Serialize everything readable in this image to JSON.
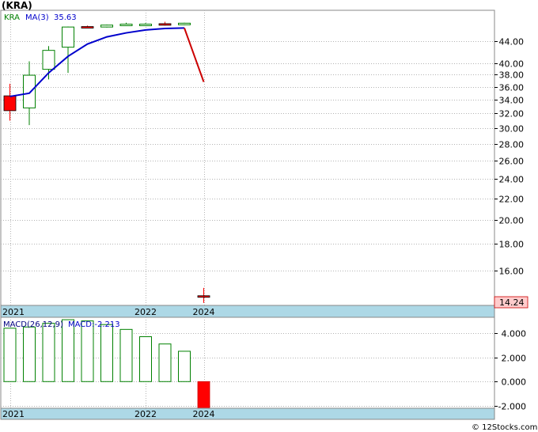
{
  "chart_data": [
    {
      "type": "candlestick",
      "title": "(KRA)",
      "legend": [
        {
          "label": "KRA",
          "color": "#008000"
        },
        {
          "label": "MA(3)",
          "color": "#0000cc"
        },
        {
          "label": "35.63",
          "color": "#0000cc"
        }
      ],
      "x_tick_labels": [
        {
          "label": "2021",
          "index": 0
        },
        {
          "label": "2022",
          "index": 7
        },
        {
          "label": "2024",
          "index": 10
        }
      ],
      "y_tick_labels": [
        "44.00",
        "40.00",
        "38.00",
        "36.00",
        "34.00",
        "32.00",
        "30.00",
        "28.00",
        "26.00",
        "24.00",
        "22.00",
        "20.00",
        "18.00",
        "16.00"
      ],
      "y_ticks": [
        44,
        40,
        38,
        36,
        34,
        32,
        30,
        28,
        26,
        24,
        22,
        20,
        18,
        16
      ],
      "y_scale": "log",
      "ylim": [
        13.7,
        50.5
      ],
      "grid": true,
      "candles": [
        {
          "open": 34.6,
          "high": 36.5,
          "low": 31.0,
          "close": 32.4,
          "color": "red"
        },
        {
          "open": 32.8,
          "high": 40.3,
          "low": 30.4,
          "close": 37.9,
          "color": "green"
        },
        {
          "open": 38.9,
          "high": 43.1,
          "low": 37.2,
          "close": 42.3,
          "color": "green"
        },
        {
          "open": 42.9,
          "high": 47.0,
          "low": 38.3,
          "close": 46.9,
          "color": "green"
        },
        {
          "open": 47.0,
          "high": 47.2,
          "low": 46.7,
          "close": 46.8,
          "color": "red"
        },
        {
          "open": 46.9,
          "high": 47.4,
          "low": 46.8,
          "close": 47.3,
          "color": "green"
        },
        {
          "open": 47.3,
          "high": 47.8,
          "low": 47.1,
          "close": 47.5,
          "color": "green"
        },
        {
          "open": 47.4,
          "high": 47.7,
          "low": 47.3,
          "close": 47.5,
          "color": "green"
        },
        {
          "open": 47.4,
          "high": 48.0,
          "low": 47.2,
          "close": 47.6,
          "color": "red"
        },
        {
          "open": 47.4,
          "high": 47.8,
          "low": 47.3,
          "close": 47.7,
          "color": "green"
        },
        {
          "open": 14.3,
          "high": 14.8,
          "low": 13.85,
          "close": 14.24,
          "color": "red"
        }
      ],
      "ma_line": [
        34.5,
        35.0,
        38.3,
        41.2,
        43.5,
        44.9,
        45.7,
        46.3,
        46.6,
        46.7,
        36.8
      ],
      "ma_colors": [
        "#0000cc",
        "#cc0000"
      ],
      "last_price_label": "14.24"
    },
    {
      "type": "bar",
      "title": "MACD(26,12,9)",
      "legend": [
        {
          "label": "MACD(26,12,9)",
          "color": "#000080"
        },
        {
          "label": "MACD:-2.213",
          "color": "#0000cc"
        }
      ],
      "x_tick_labels": [
        {
          "label": "2021",
          "index": 0
        },
        {
          "label": "2022",
          "index": 7
        },
        {
          "label": "2024",
          "index": 10
        }
      ],
      "y_tick_labels": [
        "4.000",
        "2.000",
        "0.000",
        "-2.000"
      ],
      "y_ticks": [
        4,
        2,
        0,
        -2
      ],
      "ylim": [
        -2.2,
        5.3
      ],
      "grid": true,
      "values": [
        4.4,
        4.5,
        4.8,
        5.1,
        5.0,
        4.7,
        4.3,
        3.7,
        3.1,
        2.5,
        -2.213
      ],
      "colors": [
        "green",
        "green",
        "green",
        "green",
        "green",
        "green",
        "green",
        "green",
        "green",
        "green",
        "red"
      ]
    }
  ],
  "watermark": "© 12Stocks.com"
}
